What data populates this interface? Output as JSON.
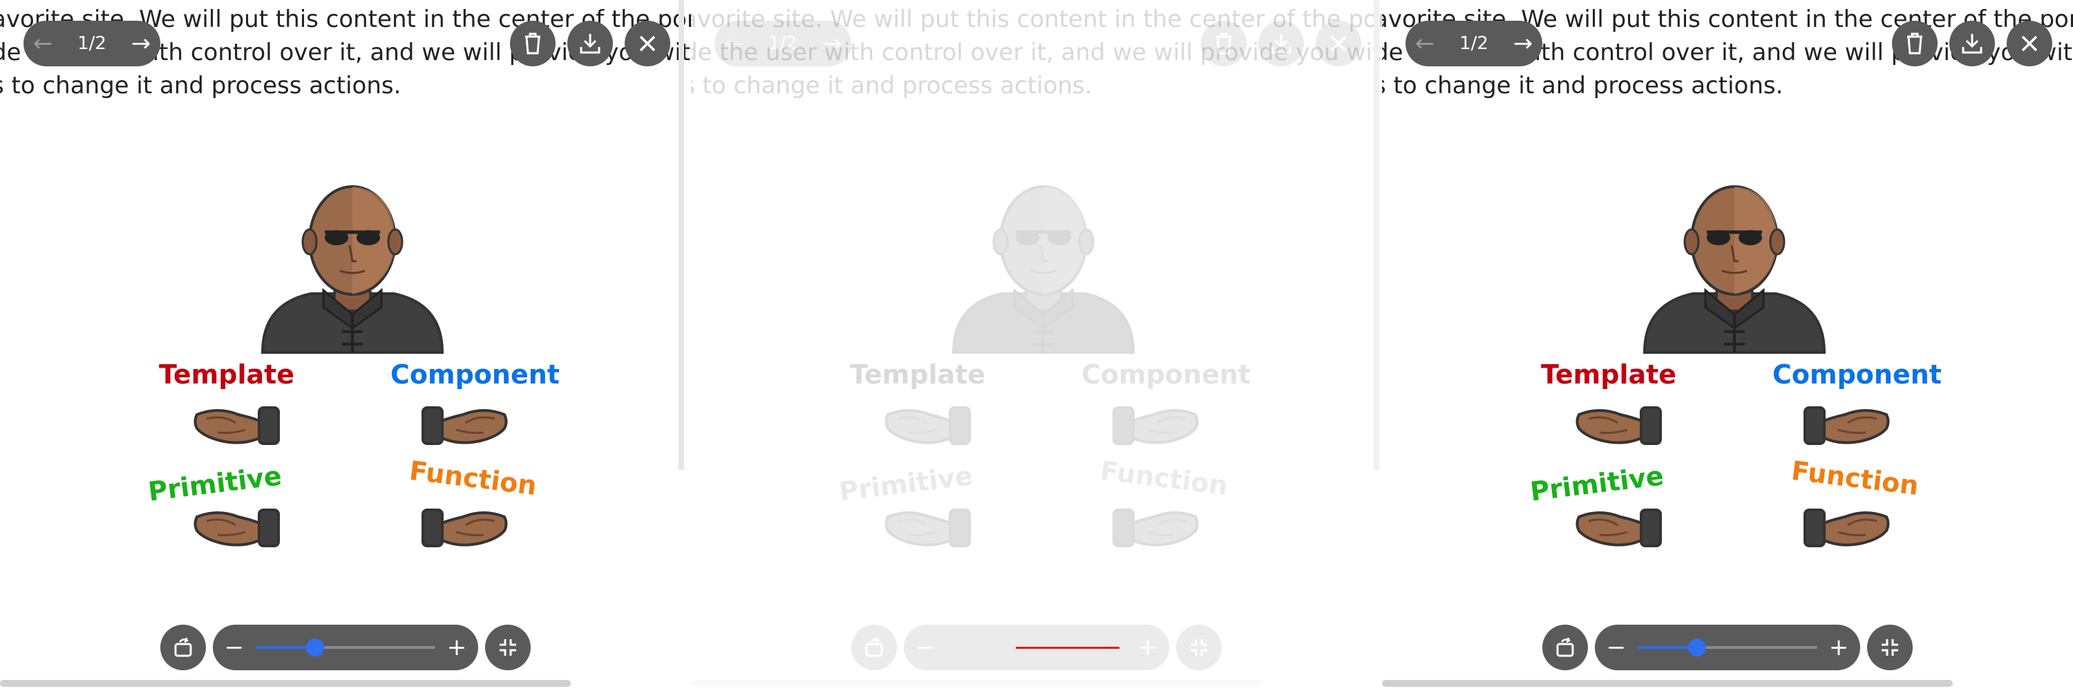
{
  "viewer": {
    "page_counter": "1/2",
    "content_text": {
      "line1": "avorite site. We will put this content in the center of the portal and",
      "line2": "de the user with control over it, and we will provide you with conve",
      "line3": "s to change it and process actions."
    },
    "labels": {
      "template": "Template",
      "component": "Component",
      "primitive": "Primitive",
      "function": "Function"
    },
    "zoom_fraction": 0.33
  },
  "icons": {
    "prev": "arrow-left-icon",
    "next": "arrow-right-icon",
    "delete": "trash-icon",
    "download": "download-icon",
    "close": "close-icon",
    "rotate": "rotate-icon",
    "zoom_out": "minus-icon",
    "zoom_in": "plus-icon",
    "exit_fullscreen": "exit-fullscreen-icon"
  },
  "colors": {
    "template": "#c00010",
    "component": "#0b72e6",
    "primitive": "#19b019",
    "function": "#f07d10",
    "control_bg": "#5a5a5a",
    "slider_accent": "#2f6ff0",
    "loading_line": "#e81818"
  }
}
